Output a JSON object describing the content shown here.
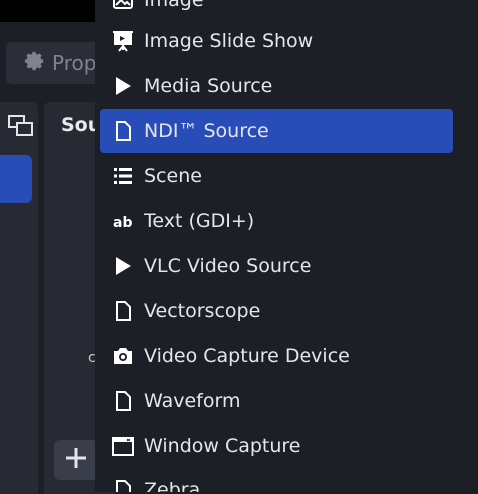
{
  "background": {
    "properties_label": "Prope",
    "sources_title": "Sou",
    "stray_char": "c"
  },
  "menu": {
    "items": [
      {
        "label": "Image",
        "icon": "image-icon"
      },
      {
        "label": "Image Slide Show",
        "icon": "slideshow-icon"
      },
      {
        "label": "Media Source",
        "icon": "play-icon"
      },
      {
        "label": "NDI™ Source",
        "icon": "file-icon",
        "selected": true
      },
      {
        "label": "Scene",
        "icon": "list-icon"
      },
      {
        "label": "Text (GDI+)",
        "icon": "text-icon"
      },
      {
        "label": "VLC Video Source",
        "icon": "play-icon"
      },
      {
        "label": "Vectorscope",
        "icon": "file-icon"
      },
      {
        "label": "Video Capture Device",
        "icon": "camera-icon"
      },
      {
        "label": "Waveform",
        "icon": "file-icon"
      },
      {
        "label": "Window Capture",
        "icon": "window-icon"
      },
      {
        "label": "Zebra",
        "icon": "file-icon"
      }
    ]
  },
  "colors": {
    "accent": "#284cb8",
    "menu_bg": "#1d1f26",
    "panel_bg": "#272a33"
  }
}
